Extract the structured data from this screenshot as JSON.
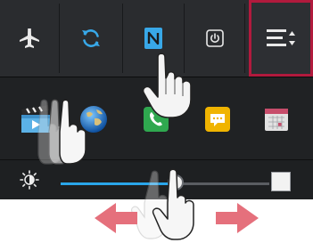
{
  "quick_settings": {
    "tiles": [
      {
        "id": "airplane",
        "icon": "airplane-icon",
        "state": "off"
      },
      {
        "id": "sync",
        "icon": "sync-icon",
        "state": "on",
        "accent": "#38a8e8"
      },
      {
        "id": "nfc",
        "icon": "nfc-icon",
        "state": "on",
        "accent": "#38a8e8"
      },
      {
        "id": "power",
        "icon": "power-icon",
        "state": "off"
      },
      {
        "id": "quick-settings-edit",
        "icon": "sort-list-icon",
        "highlight": "#b11a3d"
      }
    ]
  },
  "apps": [
    {
      "id": "videos",
      "icon": "clapperboard-icon"
    },
    {
      "id": "browser",
      "icon": "globe-icon"
    },
    {
      "id": "phone",
      "icon": "phone-icon",
      "color": "#2fa84f"
    },
    {
      "id": "messaging",
      "icon": "message-icon",
      "color": "#f0b400"
    },
    {
      "id": "calendar",
      "icon": "calendar-icon",
      "color": "#d0d0d0"
    }
  ],
  "brightness": {
    "level": 0.55,
    "auto": false,
    "fill_color": "#2aa6ea"
  },
  "gestures": [
    {
      "type": "tap",
      "target": "quick-settings-edit"
    },
    {
      "type": "drag",
      "target": "apps-row",
      "direction": "left"
    },
    {
      "type": "drag",
      "target": "brightness-slider",
      "direction": "left-right",
      "arrow_color": "#e5707c"
    }
  ]
}
